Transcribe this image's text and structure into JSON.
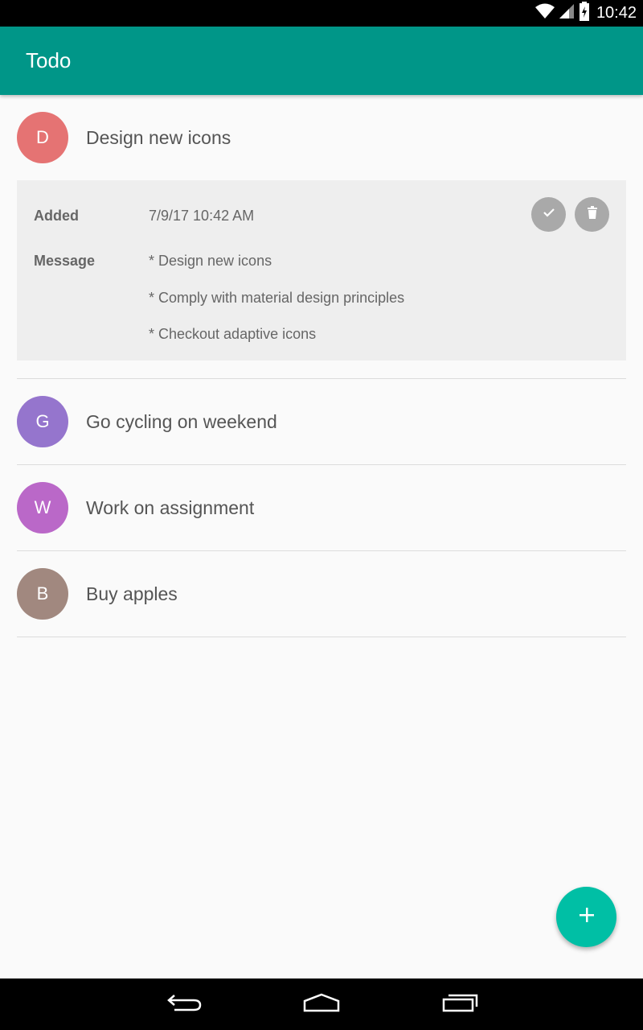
{
  "status_bar": {
    "time": "10:42"
  },
  "app_bar": {
    "title": "Todo"
  },
  "todos": [
    {
      "initial": "D",
      "title": "Design new icons",
      "avatar_color": "#e57373"
    },
    {
      "initial": "G",
      "title": "Go cycling on weekend",
      "avatar_color": "#9575cd"
    },
    {
      "initial": "W",
      "title": "Work on assignment",
      "avatar_color": "#ba68c8"
    },
    {
      "initial": "B",
      "title": "Buy apples",
      "avatar_color": "#a1887f"
    }
  ],
  "details": {
    "added_label": "Added",
    "added_value": "7/9/17 10:42 AM",
    "message_label": "Message",
    "message_lines": [
      "* Design new icons",
      "* Comply with material design principles",
      "* Checkout adaptive icons"
    ]
  },
  "colors": {
    "primary": "#009688",
    "accent": "#00bfa5",
    "action_button": "#a9a9a9"
  },
  "icons": {
    "complete": "check-icon",
    "delete": "trash-icon",
    "fab": "plus-icon",
    "nav_back": "back-icon",
    "nav_home": "home-icon",
    "nav_recents": "recents-icon"
  }
}
